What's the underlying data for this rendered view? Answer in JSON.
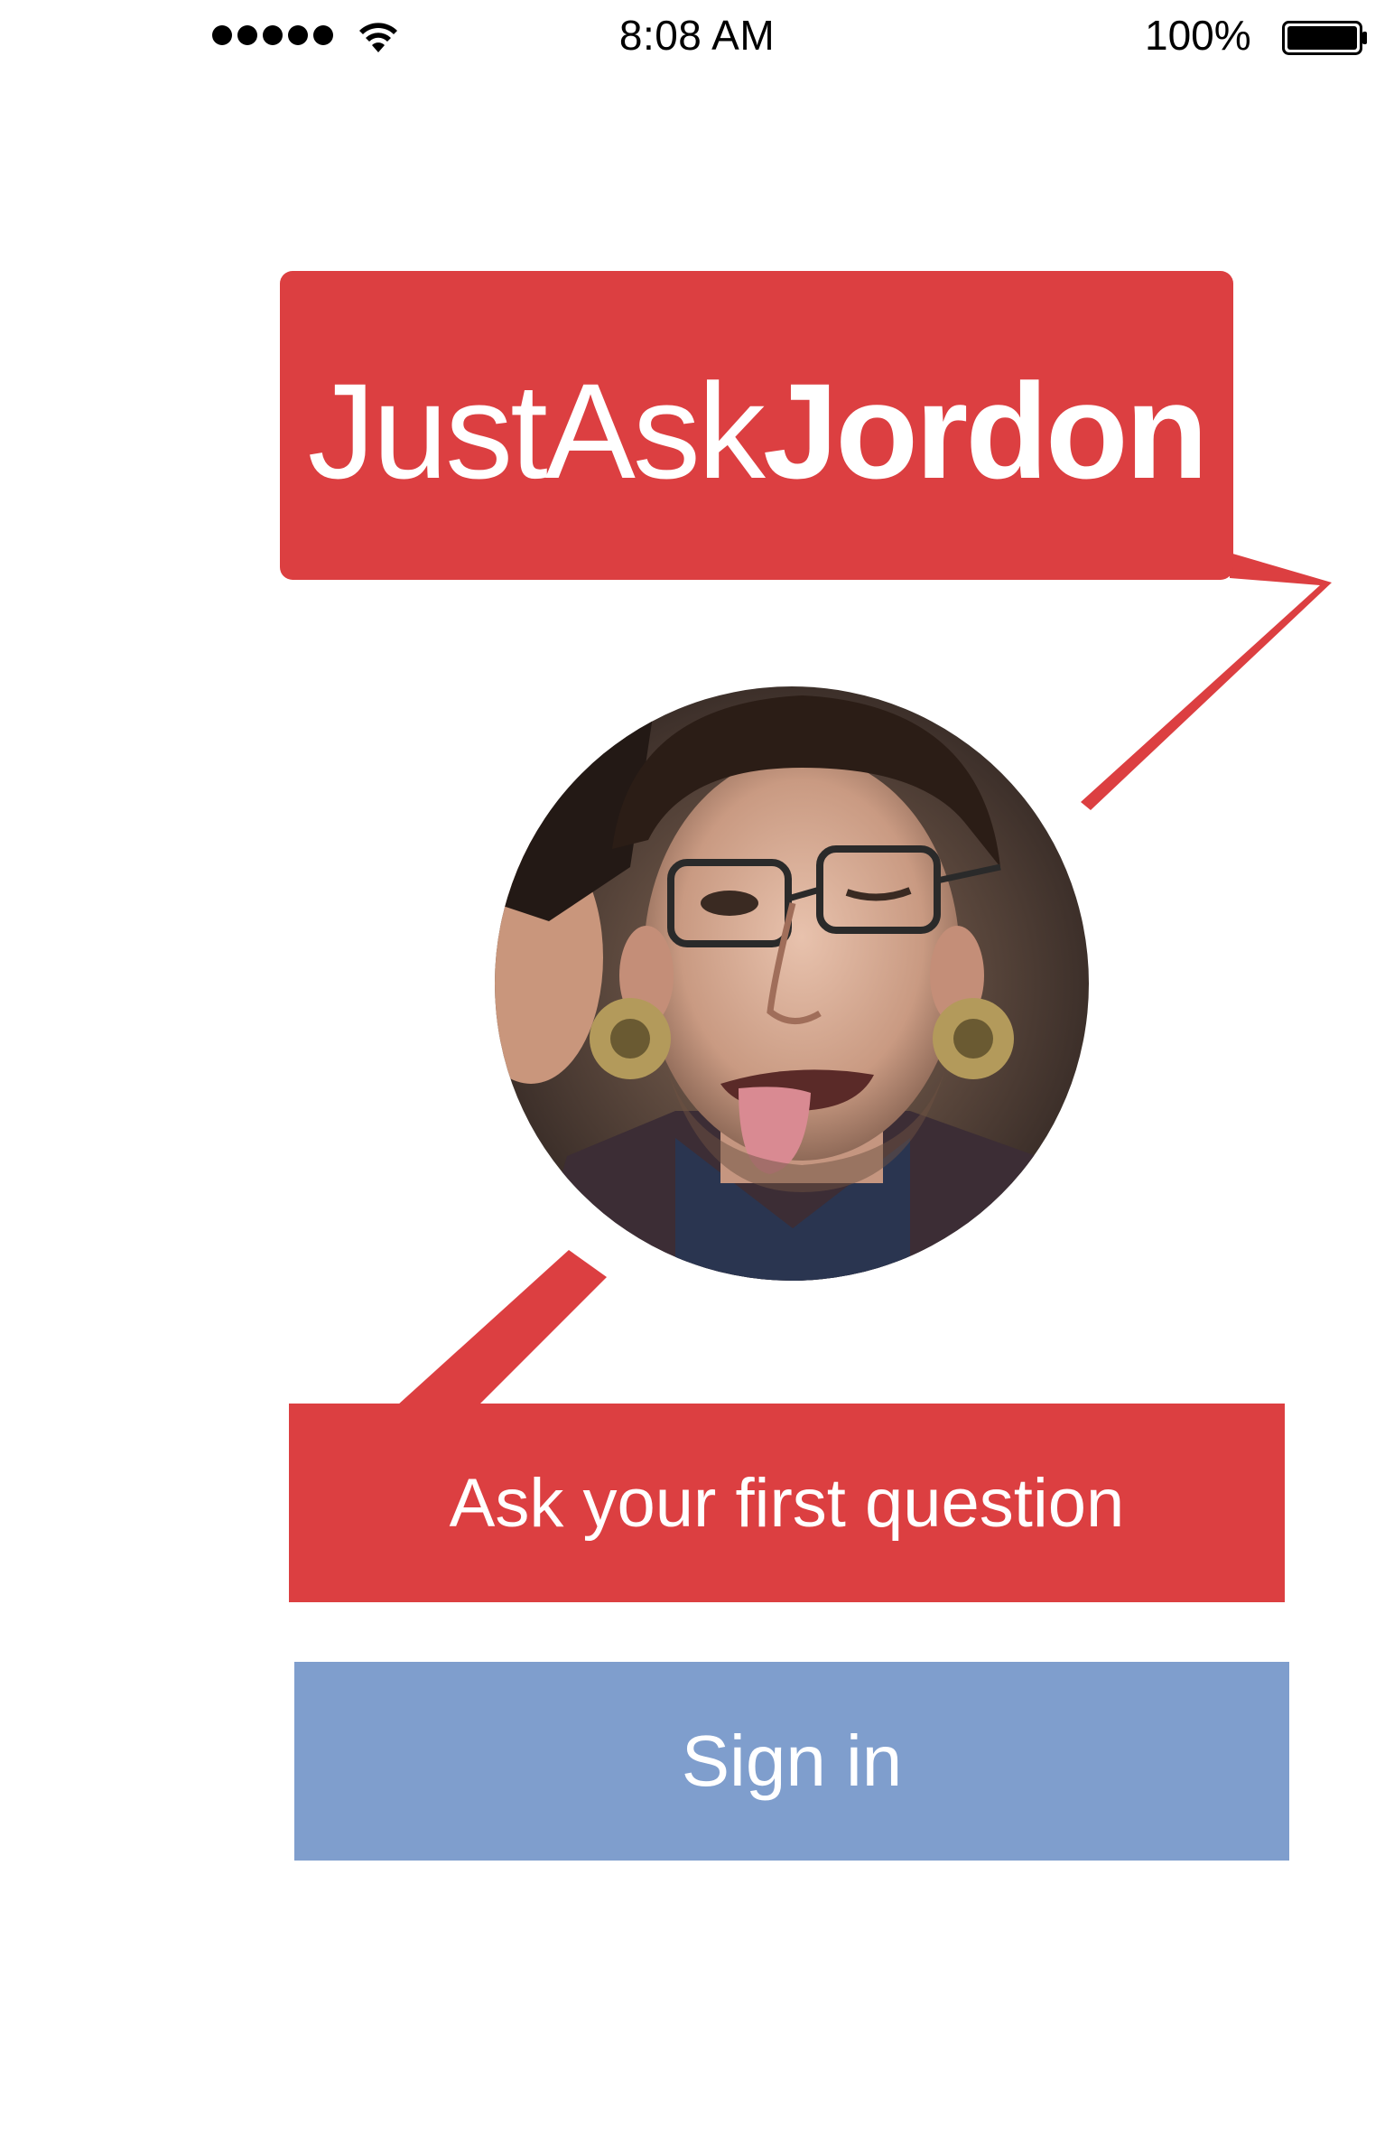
{
  "status_bar": {
    "time": "8:08 AM",
    "battery_percent": "100%",
    "signal_icon": "signal-dots-icon",
    "wifi_icon": "wifi-icon",
    "battery_icon": "battery-full-icon"
  },
  "title": {
    "part_1": "Just",
    "part_2": "Ask",
    "part_3": "Jordon"
  },
  "avatar": {
    "icon": "profile-photo"
  },
  "buttons": {
    "ask_label": "Ask your first question",
    "signin_label": "Sign in"
  },
  "colors": {
    "accent_red": "#dc3f41",
    "signin_blue": "#7f9ecd",
    "background": "#ffffff"
  }
}
